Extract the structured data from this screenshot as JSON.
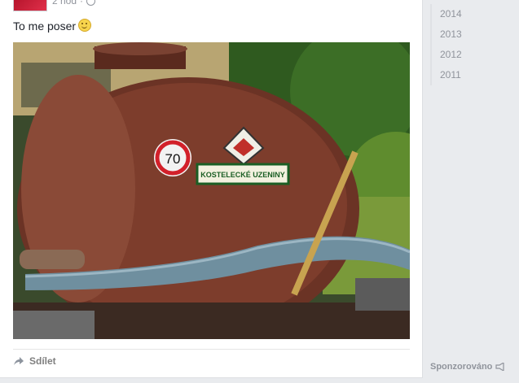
{
  "post": {
    "time": "2 hod",
    "separator": "·",
    "text": "To me poser",
    "emoji": "smiley-face-icon",
    "image_text": {
      "speed_sign": "70",
      "brand_plate": "KOSTELECKÉ UZENINY"
    },
    "share_label": "Sdílet"
  },
  "sidebar": {
    "years": [
      "2014",
      "2013",
      "2012",
      "2011"
    ],
    "sponsored_label": "Sponzorováno"
  }
}
